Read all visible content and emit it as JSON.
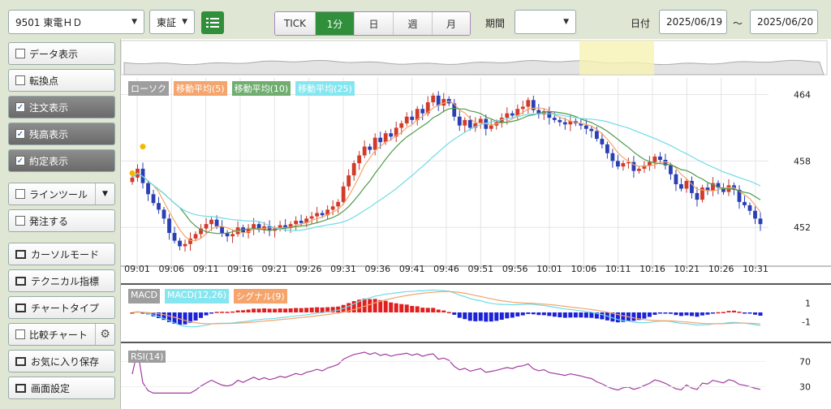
{
  "toolbar": {
    "symbol": "9501 東電ＨＤ",
    "market": "東証",
    "intervals": [
      "TICK",
      "1分",
      "日",
      "週",
      "月"
    ],
    "active_interval": "1分",
    "period_label": "期間",
    "period_value": "",
    "date_label": "日付",
    "date_from": "2025/06/19",
    "date_sep": "～",
    "date_to": "2025/06/20"
  },
  "sidebar": {
    "items": [
      {
        "label": "データ表示",
        "kind": "check",
        "checked": false
      },
      {
        "label": "転換点",
        "kind": "check",
        "checked": false
      },
      {
        "label": "注文表示",
        "kind": "check",
        "checked": true
      },
      {
        "label": "残高表示",
        "kind": "check",
        "checked": true
      },
      {
        "label": "約定表示",
        "kind": "check",
        "checked": true
      },
      {
        "label": "ラインツール",
        "kind": "check-dropdown",
        "checked": false
      },
      {
        "label": "発注する",
        "kind": "check",
        "checked": false
      },
      {
        "label": "カーソルモード",
        "kind": "window"
      },
      {
        "label": "テクニカル指標",
        "kind": "window"
      },
      {
        "label": "チャートタイプ",
        "kind": "window"
      },
      {
        "label": "比較チャート",
        "kind": "check-gear",
        "checked": false
      },
      {
        "label": "お気に入り保存",
        "kind": "window"
      },
      {
        "label": "画面設定",
        "kind": "window"
      }
    ]
  },
  "main_legend": [
    {
      "label": "ローソク",
      "color": "#9e9e9e"
    },
    {
      "label": "移動平均(5)",
      "color": "#f5a46b"
    },
    {
      "label": "移動平均(10)",
      "color": "#6fae6f"
    },
    {
      "label": "移動平均(25)",
      "color": "#86e6f0"
    }
  ],
  "macd_legend": [
    {
      "label": "MACD",
      "color": "#9e9e9e"
    },
    {
      "label": "MACD(12,26)",
      "color": "#86e6f0"
    },
    {
      "label": "シグナル(9)",
      "color": "#f5a46b"
    }
  ],
  "rsi_legend": [
    {
      "label": "RSI(14)",
      "color": "#9e9e9e"
    }
  ],
  "chart_data": {
    "type": "candlestick",
    "x_ticks": [
      "09:01",
      "09:06",
      "09:11",
      "09:16",
      "09:21",
      "09:26",
      "09:31",
      "09:36",
      "09:41",
      "09:46",
      "09:51",
      "09:56",
      "10:01",
      "10:06",
      "10:11",
      "10:16",
      "10:21",
      "10:26",
      "10:31"
    ],
    "price_ticks": [
      464,
      458,
      452
    ],
    "price_range": [
      448.5,
      465.5
    ],
    "macd_ticks": [
      1,
      -1
    ],
    "rsi_ticks": [
      70,
      30
    ],
    "close": [
      456.5,
      457.3,
      456.0,
      455.0,
      454.2,
      453.6,
      452.8,
      451.5,
      450.8,
      450.3,
      450.5,
      451.0,
      451.4,
      451.9,
      452.3,
      452.7,
      452.1,
      451.5,
      451.2,
      451.4,
      452.0,
      451.5,
      451.9,
      452.3,
      451.8,
      452.1,
      451.7,
      451.9,
      452.2,
      452.0,
      452.3,
      452.6,
      452.4,
      452.8,
      453.0,
      453.3,
      453.1,
      453.6,
      453.9,
      454.3,
      455.7,
      456.7,
      457.8,
      458.5,
      459.3,
      459.0,
      460.1,
      459.7,
      460.5,
      460.2,
      461.0,
      461.4,
      462.0,
      461.7,
      462.7,
      462.3,
      463.3,
      463.9,
      463.0,
      463.6,
      463.2,
      462.0,
      461.2,
      461.7,
      461.0,
      461.4,
      461.8,
      460.9,
      461.2,
      461.5,
      461.9,
      462.3,
      462.1,
      462.7,
      462.9,
      463.5,
      462.6,
      462.2,
      462.5,
      461.9,
      461.7,
      461.5,
      461.3,
      461.6,
      461.4,
      461.2,
      460.9,
      460.7,
      460.0,
      459.5,
      458.7,
      458.0,
      457.5,
      457.8,
      457.9,
      457.1,
      457.3,
      457.6,
      457.9,
      458.4,
      458.1,
      457.6,
      456.8,
      455.9,
      455.5,
      456.2,
      455.1,
      454.5,
      455.6,
      455.3,
      456.0,
      455.6,
      455.2,
      455.8,
      455.4,
      454.3,
      454.0,
      453.5,
      452.8,
      452.3
    ],
    "ma_periods": [
      5,
      10,
      25
    ],
    "macd_range": [
      -3.0,
      3.0
    ],
    "rsi_range": [
      0,
      100
    ]
  }
}
